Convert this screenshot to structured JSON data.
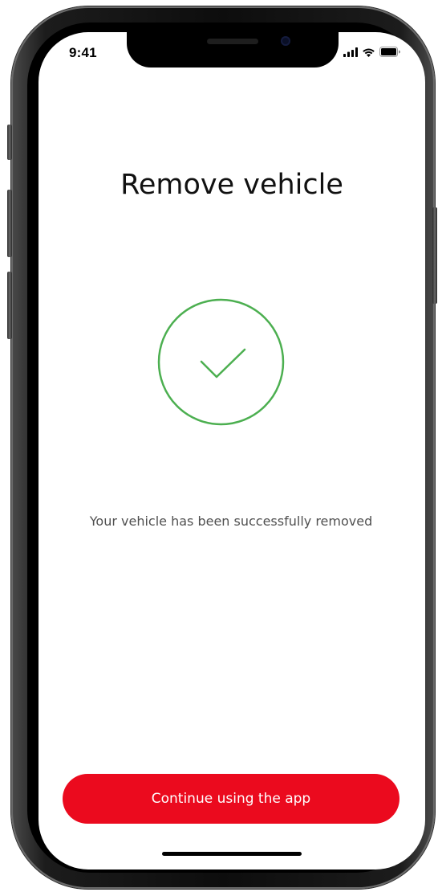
{
  "status_bar": {
    "time": "9:41",
    "icons": [
      "cellular-signal-icon",
      "wifi-icon",
      "battery-icon"
    ]
  },
  "screen": {
    "title": "Remove vehicle",
    "success_icon": "checkmark-circle-icon",
    "message": "Your vehicle has been successfully removed"
  },
  "actions": {
    "continue_label": "Continue using the app"
  },
  "colors": {
    "accent": "#EB0A1E",
    "success": "#4CAF50",
    "text_primary": "#111111",
    "text_secondary": "#505050"
  }
}
